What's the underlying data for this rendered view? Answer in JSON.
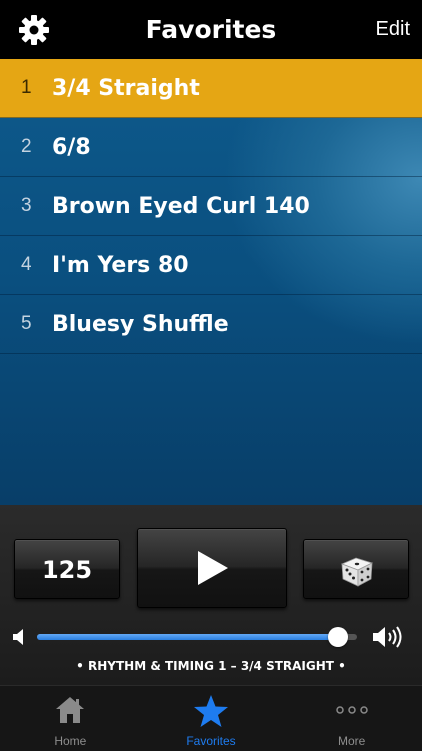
{
  "header": {
    "title": "Favorites",
    "edit_label": "Edit",
    "settings_icon": "gear-icon"
  },
  "favorites": [
    {
      "num": "1",
      "name": "3/4 Straight",
      "selected": true
    },
    {
      "num": "2",
      "name": "6/8",
      "selected": false
    },
    {
      "num": "3",
      "name": "Brown Eyed Curl 140",
      "selected": false
    },
    {
      "num": "4",
      "name": "I'm Yers 80",
      "selected": false
    },
    {
      "num": "5",
      "name": "Bluesy Shuffle",
      "selected": false
    }
  ],
  "controls": {
    "tempo": "125",
    "play_icon": "play-icon",
    "random_icon": "dice-icon",
    "volume_level": 0.94,
    "now_playing": "• RHYTHM & TIMING 1 – 3/4 STRAIGHT •"
  },
  "tabs": [
    {
      "label": "Home",
      "icon": "home-icon",
      "active": false
    },
    {
      "label": "Favorites",
      "icon": "star-icon",
      "active": true
    },
    {
      "label": "More",
      "icon": "more-icon",
      "active": false
    }
  ],
  "colors": {
    "accent": "#1e7cf0",
    "selected_row": "#e5a614",
    "list_bg": "#0e5a8c"
  }
}
